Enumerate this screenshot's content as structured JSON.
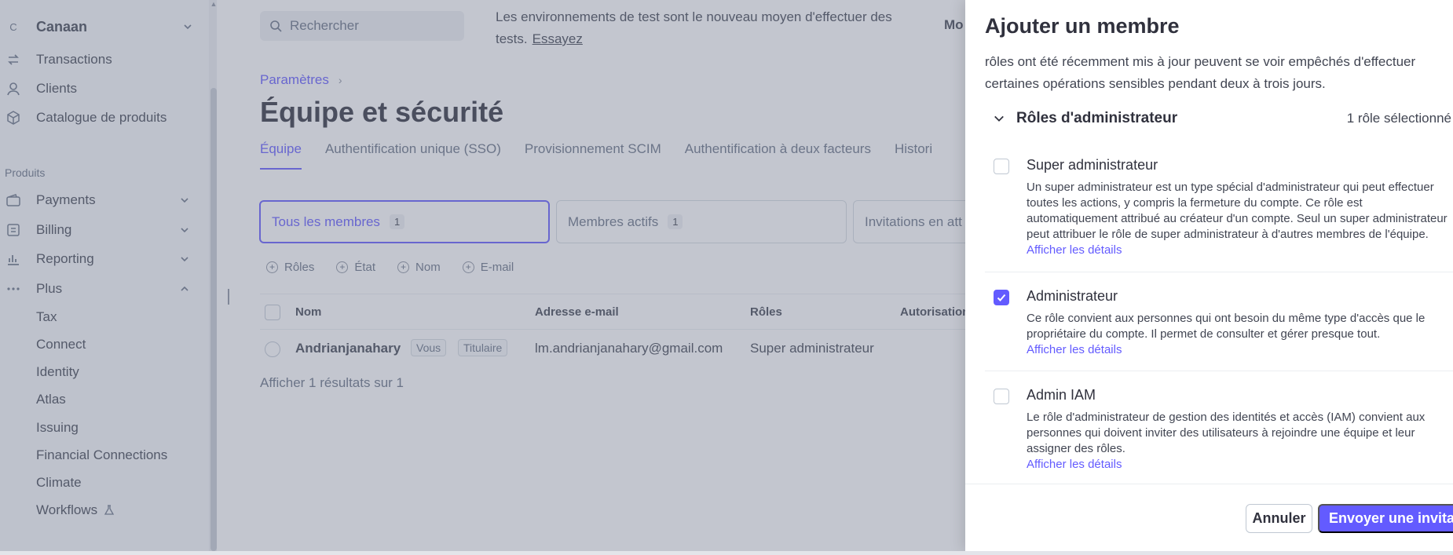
{
  "sidebar": {
    "account": {
      "avatar": "C",
      "name": "Canaan"
    },
    "items": [
      {
        "label": "Transactions",
        "icon": "arrows-swap-icon"
      },
      {
        "label": "Clients",
        "icon": "person-icon"
      },
      {
        "label": "Catalogue de produits",
        "icon": "box-icon"
      }
    ],
    "section_title": "Produits",
    "product_items": [
      {
        "label": "Payments",
        "icon": "wallet-icon"
      },
      {
        "label": "Billing",
        "icon": "billing-icon"
      },
      {
        "label": "Reporting",
        "icon": "bar-chart-icon"
      },
      {
        "label": "Plus",
        "icon": "more-dots-icon"
      }
    ],
    "sub_items": [
      "Tax",
      "Connect",
      "Identity",
      "Atlas",
      "Issuing",
      "Financial Connections",
      "Climate",
      "Workflows"
    ]
  },
  "topbar": {
    "search_placeholder": "Rechercher",
    "notice": "Les environnements de test sont le nouveau moyen d'effectuer des tests.",
    "notice_link": "Essayez",
    "mode_label": "Mo"
  },
  "main": {
    "breadcrumb": "Paramètres",
    "title": "Équipe et sécurité",
    "tabs": [
      "Équipe",
      "Authentification unique (SSO)",
      "Provisionnement SCIM",
      "Authentification à deux facteurs",
      "Histori"
    ],
    "filter_cards": [
      {
        "label": "Tous les membres",
        "count": "1"
      },
      {
        "label": "Membres actifs",
        "count": "1"
      },
      {
        "label": "Invitations en att",
        "count": ""
      }
    ],
    "chips": [
      "Rôles",
      "État",
      "Nom",
      "E-mail"
    ],
    "table": {
      "headers": [
        "Nom",
        "Adresse e-mail",
        "Rôles",
        "Autorisation"
      ],
      "row": {
        "name": "Andrianjanahary",
        "badges": [
          "Vous",
          "Titulaire"
        ],
        "email": "lm.andrianjanahary@gmail.com",
        "role": "Super administrateur"
      }
    },
    "results": "Afficher 1 résultats sur 1"
  },
  "panel": {
    "title": "Ajouter un membre",
    "intro": "rôles ont été récemment mis à jour peuvent se voir empêchés d'effectuer certaines opérations sensibles pendant deux à trois jours.",
    "group_title": "Rôles d'administrateur",
    "group_count": "1 rôle sélectionné",
    "roles": [
      {
        "name": "Super administrateur",
        "checked": false,
        "description": "Un super administrateur est un type spécial d'administrateur qui peut effectuer toutes les actions, y compris la fermeture du compte. Ce rôle est automatiquement attribué au créateur d'un compte. Seul un super administrateur peut attribuer le rôle de super administrateur à d'autres membres de l'équipe.",
        "link": "Afficher les détails"
      },
      {
        "name": "Administrateur",
        "checked": true,
        "description": "Ce rôle convient aux personnes qui ont besoin du même type d'accès que le propriétaire du compte. Il permet de consulter et gérer presque tout.",
        "link": "Afficher les détails"
      },
      {
        "name": "Admin IAM",
        "checked": false,
        "description": "Le rôle d'administrateur de gestion des identités et accès (IAM) convient aux personnes qui doivent inviter des utilisateurs à rejoindre une équipe et leur assigner des rôles.",
        "link": "Afficher les détails"
      }
    ],
    "cancel_label": "Annuler",
    "send_label": "Envoyer une invitatio"
  },
  "colors": {
    "accent": "#635bff",
    "overlay": "#71788c"
  }
}
